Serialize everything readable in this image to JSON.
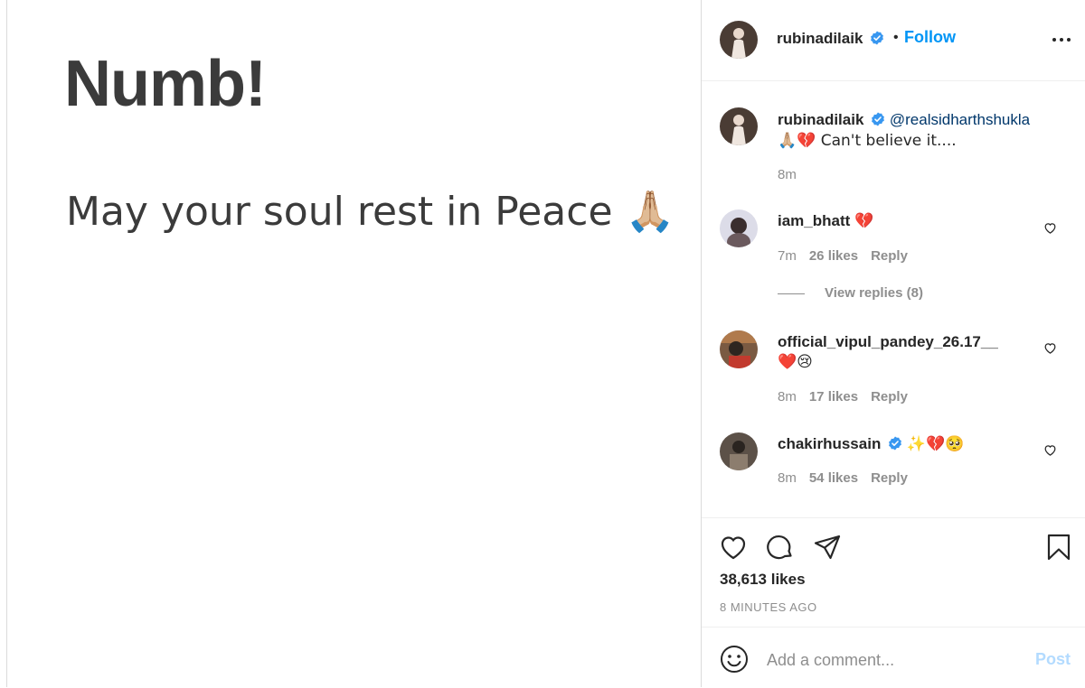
{
  "post": {
    "heading": "Numb!",
    "subtext": "May your soul rest in Peace 🙏🏼"
  },
  "header": {
    "username": "rubinadilaik",
    "separator": "•",
    "follow_label": "Follow",
    "more_icon": "more-options-icon"
  },
  "caption": {
    "username": "rubinadilaik",
    "mention": "@realsidharthshukla",
    "text": "🙏🏼💔 Can't believe it....",
    "time": "8m"
  },
  "comments": [
    {
      "username": "iam_bhatt",
      "text": "💔",
      "time": "7m",
      "likes": "26 likes",
      "reply_label": "Reply",
      "view_replies": "View replies (8)"
    },
    {
      "username": "official_vipul_pandey_26.17__",
      "text": "❤️😢",
      "time": "8m",
      "likes": "17 likes",
      "reply_label": "Reply"
    },
    {
      "username": "chakirhussain",
      "text": "✨💔🥺",
      "time": "8m",
      "likes": "54 likes",
      "reply_label": "Reply"
    }
  ],
  "actions": {
    "likes": "38,613 likes",
    "time_ago": "8 MINUTES AGO"
  },
  "add_comment": {
    "placeholder": "Add a comment...",
    "post_label": "Post"
  },
  "colors": {
    "accent": "#0095f6",
    "verified": "#3897f0",
    "muted": "#8e8e8e",
    "post_disabled": "#b3dbff"
  }
}
